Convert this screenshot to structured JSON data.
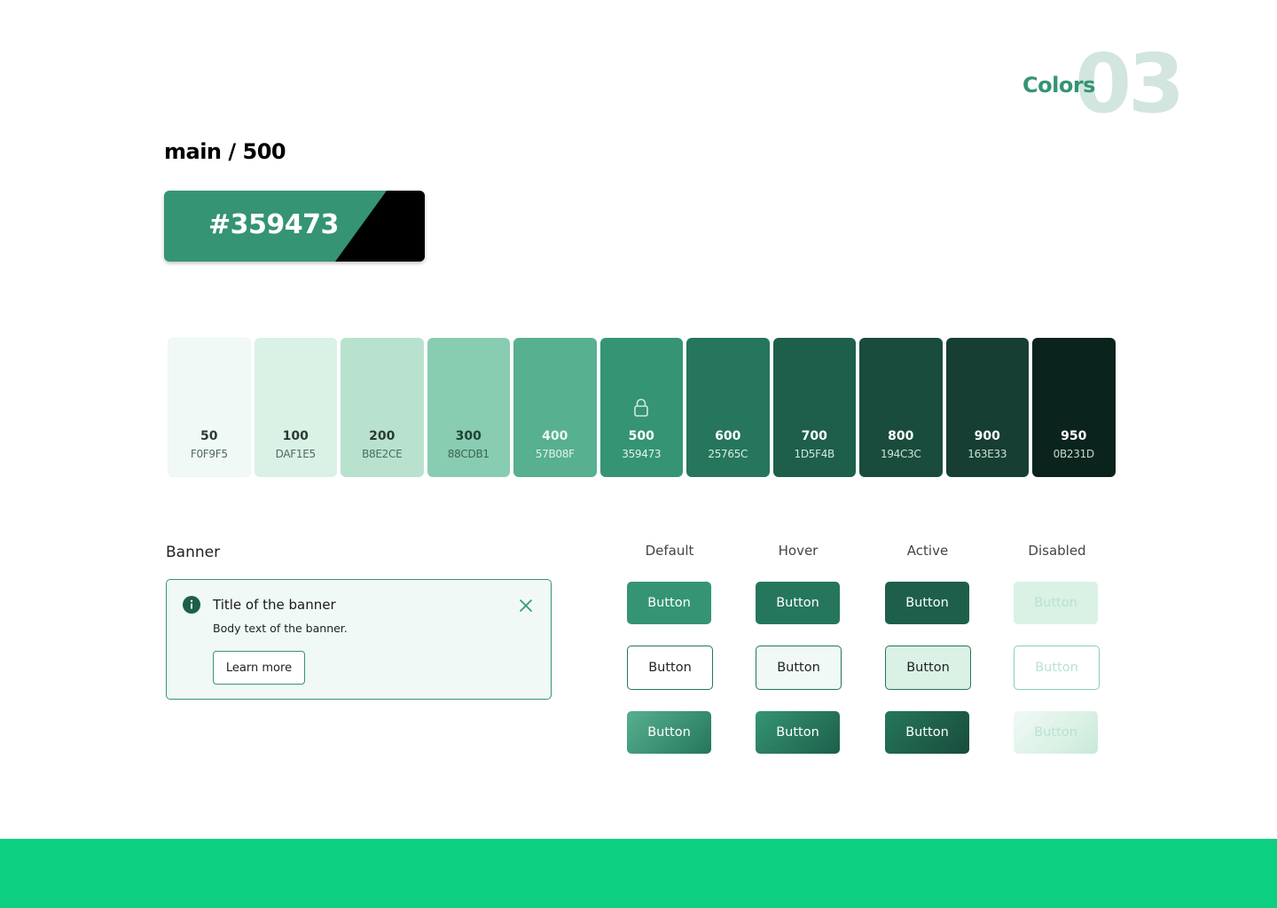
{
  "header": {
    "section_word": "Colors",
    "section_number": "03"
  },
  "main_color": {
    "title": "main / 500",
    "hex": "#359473",
    "color": "#359473",
    "accent_color": "#000000"
  },
  "scale": [
    {
      "num": "50",
      "code": "F0F9F5",
      "bg": "#f0f9f5",
      "num_color": "#2b3a34",
      "code_color": "#4e6b5f"
    },
    {
      "num": "100",
      "code": "DAF1E5",
      "bg": "#daf1e5",
      "num_color": "#2b3a34",
      "code_color": "#4e6b5f"
    },
    {
      "num": "200",
      "code": "B8E2CE",
      "bg": "#b8e2ce",
      "num_color": "#2b3a34",
      "code_color": "#4e6b5f"
    },
    {
      "num": "300",
      "code": "88CDB1",
      "bg": "#88cdb1",
      "num_color": "#244034",
      "code_color": "#3d6355"
    },
    {
      "num": "400",
      "code": "57B08F",
      "bg": "#57b08f",
      "num_color": "#eaf6f0",
      "code_color": "#e2f3ea"
    },
    {
      "num": "500",
      "code": "359473",
      "bg": "#359473",
      "num_color": "#ffffff",
      "code_color": "#e4f3ec",
      "locked": true,
      "icon": "lock-icon"
    },
    {
      "num": "600",
      "code": "25765C",
      "bg": "#25765c",
      "num_color": "#ffffff",
      "code_color": "#d9eee4"
    },
    {
      "num": "700",
      "code": "1D5F4B",
      "bg": "#1d5f4b",
      "num_color": "#ffffff",
      "code_color": "#d2e8de"
    },
    {
      "num": "800",
      "code": "194C3C",
      "bg": "#194c3c",
      "num_color": "#ffffff",
      "code_color": "#cfe4da"
    },
    {
      "num": "900",
      "code": "163E33",
      "bg": "#163e33",
      "num_color": "#ffffff",
      "code_color": "#cbe0d6"
    },
    {
      "num": "950",
      "code": "0B231D",
      "bg": "#0b231d",
      "num_color": "#ffffff",
      "code_color": "#c4d9cf"
    }
  ],
  "banner": {
    "label": "Banner",
    "title": "Title of the banner",
    "body": "Body text of the banner.",
    "action": "Learn more",
    "icon": "info-icon",
    "close_icon": "close-icon"
  },
  "states": [
    "Default",
    "Hover",
    "Active",
    "Disabled"
  ],
  "buttons": {
    "label": "Button"
  },
  "colors": {
    "footer": "#0dcf82",
    "header_number": "#d2e5de",
    "header_word": "#359473",
    "default": "#359473",
    "hover": "#25765c",
    "active": "#1d5f4b",
    "disabled_bg": "#daf1e5",
    "disabled_text": "#b8e2ce"
  }
}
